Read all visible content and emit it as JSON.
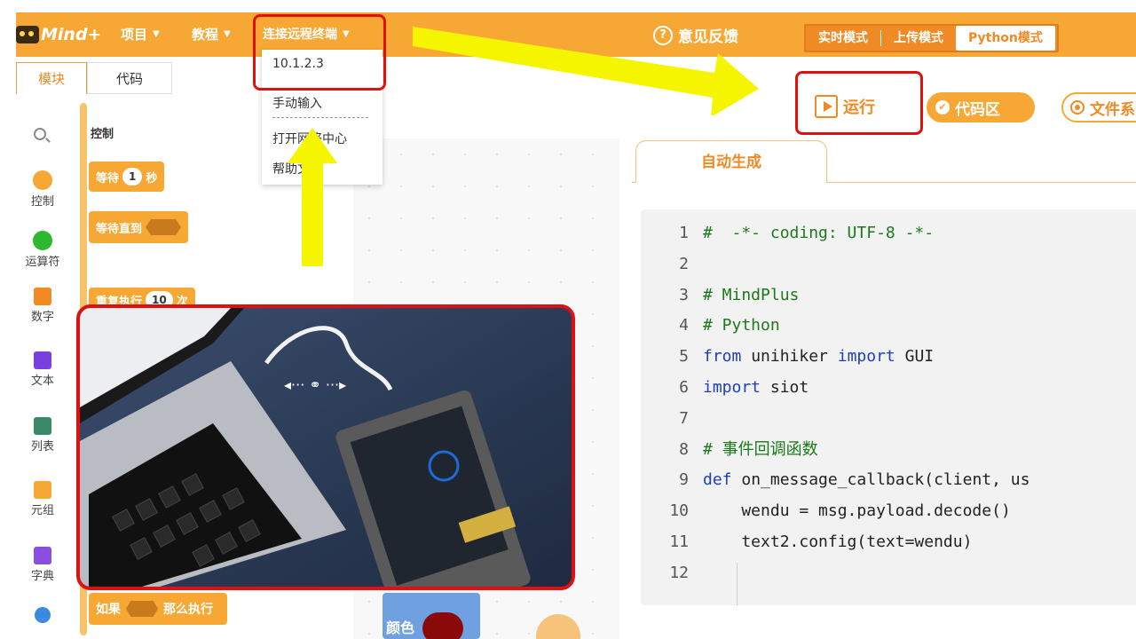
{
  "topbar": {
    "logo_text": "Mind+",
    "menu": [
      {
        "label": "项目"
      },
      {
        "label": "教程"
      },
      {
        "label": "连接远程终端"
      }
    ],
    "feedback_label": "意见反馈",
    "modes": [
      {
        "label": "实时模式"
      },
      {
        "label": "上传模式"
      },
      {
        "label": "Python模式"
      }
    ]
  },
  "left_tabs": {
    "modules": "模块",
    "code": "代码"
  },
  "dropdown": {
    "items": [
      {
        "label": "10.1.2.3"
      },
      {
        "label": "手动输入"
      },
      {
        "label": "打开网络中心"
      },
      {
        "label": "帮助文档"
      }
    ]
  },
  "categories": [
    {
      "label": "控制",
      "color": "#f7a733"
    },
    {
      "label": "运算符",
      "color": "#2eb82e"
    },
    {
      "label": "数字",
      "color": "#f08a24"
    },
    {
      "label": "文本",
      "color": "#7b3fe0"
    },
    {
      "label": "列表",
      "color": "#3a8a6a"
    },
    {
      "label": "元组",
      "color": "#f7a733"
    },
    {
      "label": "字典",
      "color": "#8a4fe0"
    }
  ],
  "palette": {
    "title": "控制",
    "blocks": {
      "wait_prefix": "等待",
      "wait_value": "1",
      "wait_unit": "秒",
      "wait_until": "等待直到",
      "repeat_prefix": "重复执行",
      "repeat_value": "10",
      "repeat_unit": "次",
      "if_prefix": "如果",
      "if_then": "那么执行"
    },
    "color_block_label": "颜色"
  },
  "toolbar": {
    "run_label": "运行",
    "codezone_label": "代码区",
    "files_label": "文件系"
  },
  "code_panel": {
    "tab_label": "自动生成",
    "lines": [
      {
        "n": "1",
        "text": "#  -*- coding: UTF-8 -*-",
        "cls": "c-com"
      },
      {
        "n": "2",
        "text": "",
        "cls": "c-plain"
      },
      {
        "n": "3",
        "text": "# MindPlus",
        "cls": "c-com"
      },
      {
        "n": "4",
        "text": "# Python",
        "cls": "c-com"
      },
      {
        "n": "5",
        "parts": [
          {
            "t": "from",
            "c": "c-kw"
          },
          {
            "t": " unihiker ",
            "c": "c-plain"
          },
          {
            "t": "import",
            "c": "c-kw"
          },
          {
            "t": " GUI",
            "c": "c-plain"
          }
        ]
      },
      {
        "n": "6",
        "parts": [
          {
            "t": "import",
            "c": "c-kw"
          },
          {
            "t": " siot",
            "c": "c-plain"
          }
        ]
      },
      {
        "n": "7",
        "text": "",
        "cls": "c-plain"
      },
      {
        "n": "8",
        "text": "# 事件回调函数",
        "cls": "c-com"
      },
      {
        "n": "9",
        "parts": [
          {
            "t": "def",
            "c": "c-kw"
          },
          {
            "t": " on_message_callback(client, us",
            "c": "c-plain"
          }
        ]
      },
      {
        "n": "10",
        "text": "    wendu = msg.payload.decode()",
        "cls": "c-plain"
      },
      {
        "n": "11",
        "text": "    text2.config(text=wendu)",
        "cls": "c-plain"
      },
      {
        "n": "12",
        "text": "",
        "cls": "c-plain"
      }
    ]
  },
  "colors": {
    "brand_orange": "#f7a733",
    "highlight_red": "#e01010",
    "arrow_yellow": "#f5f500"
  }
}
